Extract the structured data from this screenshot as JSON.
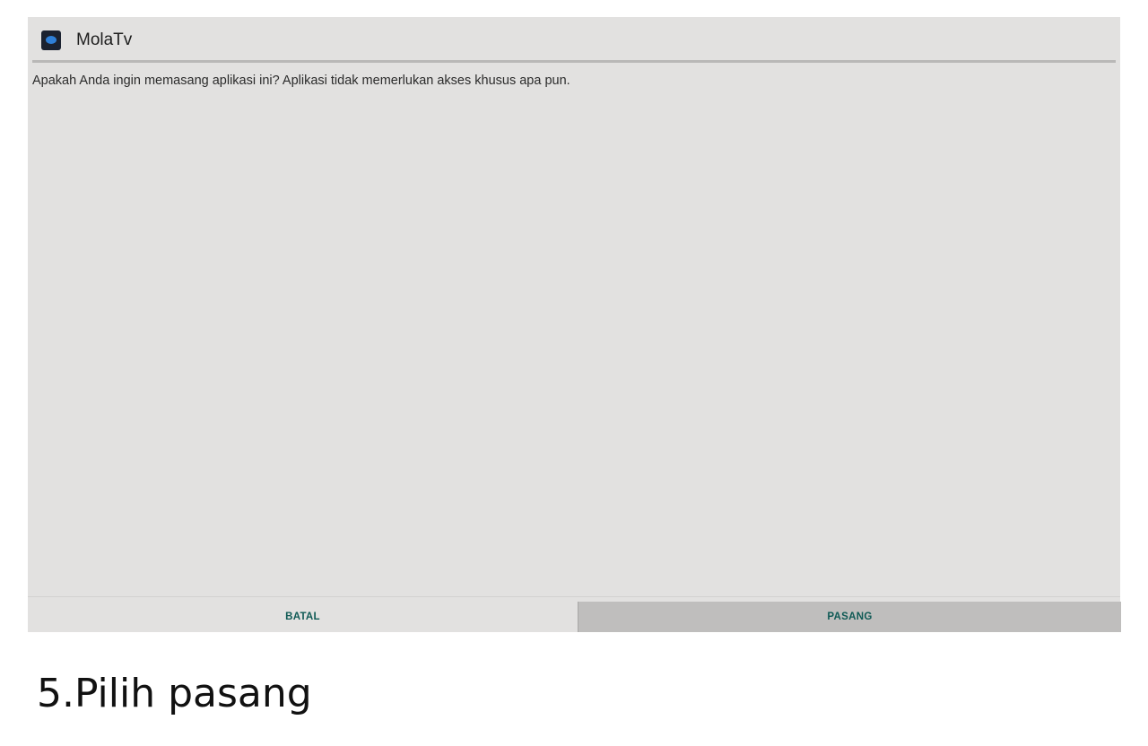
{
  "app": {
    "name": "MolaTv",
    "icon": "molatv-app-icon"
  },
  "dialog": {
    "message": "Apakah Anda ingin memasang aplikasi ini? Aplikasi tidak memerlukan akses khusus apa pun.",
    "cancel_label": "BATAL",
    "install_label": "PASANG"
  },
  "caption": "5.Pilih pasang",
  "colors": {
    "background": "#e2e1e0",
    "button_text": "#0f5a55",
    "pressed_button": "#bfbebd"
  }
}
